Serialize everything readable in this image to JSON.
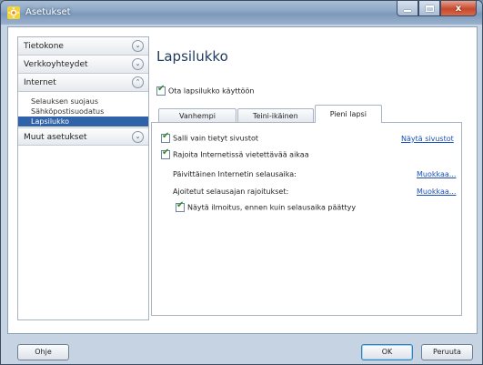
{
  "window": {
    "title": "Asetukset",
    "minimize_label": "",
    "maximize_label": "",
    "close_label": "x"
  },
  "sidebar": {
    "sections": [
      {
        "label": "Tietokone",
        "chevron": "⌄"
      },
      {
        "label": "Verkkoyhteydet",
        "chevron": "⌄"
      },
      {
        "label": "Internet",
        "chevron": "⌃"
      }
    ],
    "internet_items": [
      "Selauksen suojaus",
      "Sähköpostisuodatus",
      "Lapsilukko"
    ],
    "selected_item": "Lapsilukko",
    "last_section": {
      "label": "Muut asetukset",
      "chevron": "⌄"
    }
  },
  "main": {
    "title": "Lapsilukko",
    "enable_checkbox": {
      "label": "Ota lapsilukko käyttöön",
      "checked": true
    },
    "tabs": [
      {
        "label": "Vanhempi"
      },
      {
        "label": "Teini-ikäinen"
      },
      {
        "label": "Pieni lapsi"
      }
    ],
    "active_tab": "Pieni lapsi",
    "panel": {
      "allow_sites": {
        "label": "Salli vain tietyt sivustot",
        "checked": true,
        "link": "Näytä sivustot"
      },
      "limit_time": {
        "label": "Rajoita Internetissä vietettävää aikaa",
        "checked": true
      },
      "daily_time": {
        "label": "Päivittäinen Internetin selausaika:",
        "link": "Muokkaa..."
      },
      "scheduled": {
        "label": "Ajoitetut selausajan rajoitukset:",
        "link": "Muokkaa..."
      },
      "notify": {
        "label": "Näytä ilmoitus, ennen kuin selausaika päättyy",
        "checked": true
      }
    }
  },
  "footer": {
    "help_label": "Ohje",
    "ok_label": "OK",
    "cancel_label": "Peruuta"
  }
}
